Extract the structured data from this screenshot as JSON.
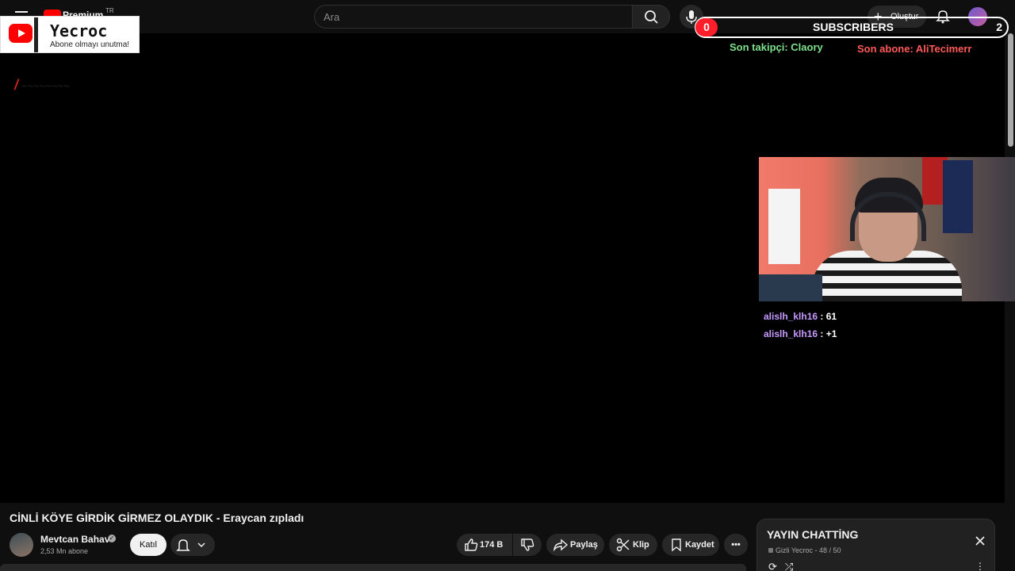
{
  "topbar": {
    "brand": "Premium",
    "region": "TR",
    "search_placeholder": "Ara",
    "create_label": "Oluştur",
    "icons": [
      "menu-icon",
      "search-icon",
      "mic-icon",
      "plus-icon",
      "bell-icon"
    ]
  },
  "overlay": {
    "channel_name": "Yecroc",
    "channel_tagline": "Abone olmayı unutma!",
    "subs_left": "0",
    "subs_label": "SUBSCRIBERS",
    "subs_right": "2",
    "last_follower": "Son takipçi: Claory",
    "last_subscriber": "Son abone: AliTecimerr",
    "follower_color": "#7ee08c",
    "subscriber_color": "#ff5a5a"
  },
  "stream_chat": [
    {
      "user": "alislh_klh16",
      "message": ": 61"
    },
    {
      "user": "alislh_klh16",
      "message": ": +1"
    }
  ],
  "video": {
    "title": "CİNLİ KÖYE GİRDİK GİRMEZ OLAYDIK - Eraycan zıpladı",
    "owner_name": "Mevtcan Bahav",
    "owner_subs": "2,53 Mn abone",
    "join_label": "Katıl",
    "like_count": "174 B",
    "share_label": "Paylaş",
    "clip_label": "Klip",
    "save_label": "Kaydet"
  },
  "live_chat": {
    "title": "YAYIN CHATTİNG",
    "visibility": "Gizli",
    "channel": "Yecroc",
    "count": "- 48 / 50"
  }
}
